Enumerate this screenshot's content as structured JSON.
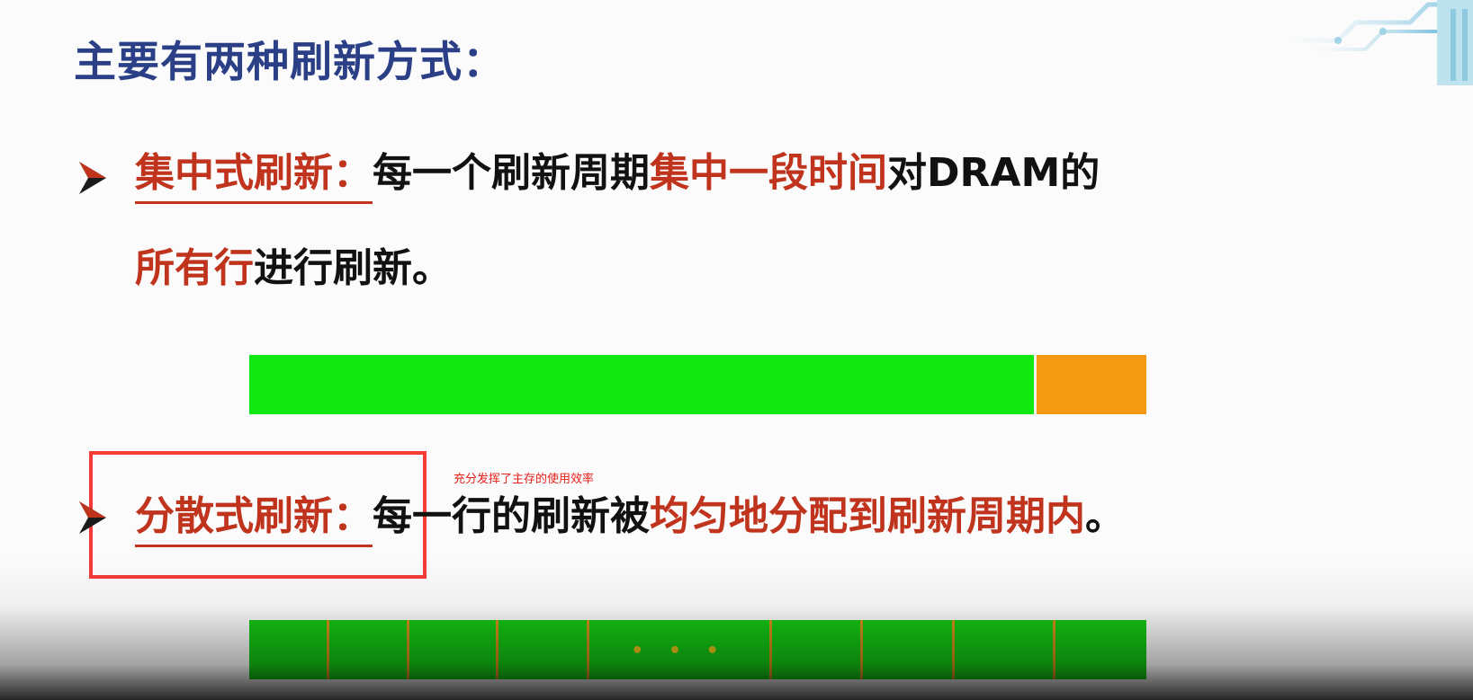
{
  "slide": {
    "title": "主要有两种刷新方式：",
    "bullet1": {
      "term": "集中式刷新：",
      "line1_a": "每一个刷新周期",
      "line1_b": "集中一段时间",
      "line1_c": "对DRAM的",
      "line2_a": "所有行",
      "line2_b": "进行刷新。"
    },
    "bullet2": {
      "term": "分散式刷新：",
      "text_a": "每一行的刷新被",
      "text_b": "均匀地分配到刷新周期内",
      "text_c": "。"
    },
    "distributed_bar_ellipsis": "• • •"
  },
  "annotation": {
    "note": "充分发挥了主存的使用效率"
  },
  "colors": {
    "title": "#2a3f85",
    "highlight": "#c0331d",
    "bar_green": "#11e811",
    "bar_orange": "#f49a12",
    "annotation_red": "#f53a3a"
  },
  "icons": {
    "bullet": "arrowhead-bullet-icon"
  }
}
